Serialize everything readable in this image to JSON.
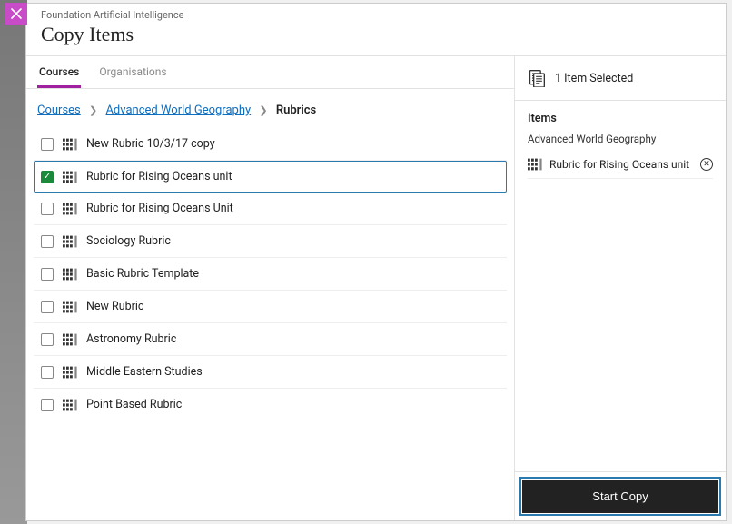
{
  "header": {
    "supertitle": "Foundation Artificial Intelligence",
    "title": "Copy Items"
  },
  "tabs": [
    {
      "label": "Courses",
      "active": true
    },
    {
      "label": "Organisations",
      "active": false
    }
  ],
  "breadcrumb": {
    "root": "Courses",
    "course": "Advanced World Geography",
    "current": "Rubrics"
  },
  "rubrics": [
    {
      "label": "New Rubric 10/3/17 copy",
      "checked": false
    },
    {
      "label": "Rubric for Rising Oceans unit",
      "checked": true
    },
    {
      "label": "Rubric for Rising Oceans Unit",
      "checked": false
    },
    {
      "label": "Sociology Rubric",
      "checked": false
    },
    {
      "label": "Basic Rubric Template",
      "checked": false
    },
    {
      "label": "New Rubric",
      "checked": false
    },
    {
      "label": "Astronomy Rubric",
      "checked": false
    },
    {
      "label": "Middle Eastern Studies",
      "checked": false
    },
    {
      "label": "Point Based Rubric",
      "checked": false
    }
  ],
  "selection": {
    "count_label": "1 Item Selected",
    "section_title": "Items",
    "course_name": "Advanced World Geography",
    "items": [
      {
        "label": "Rubric for Rising Oceans unit"
      }
    ]
  },
  "actions": {
    "start_copy": "Start Copy"
  }
}
